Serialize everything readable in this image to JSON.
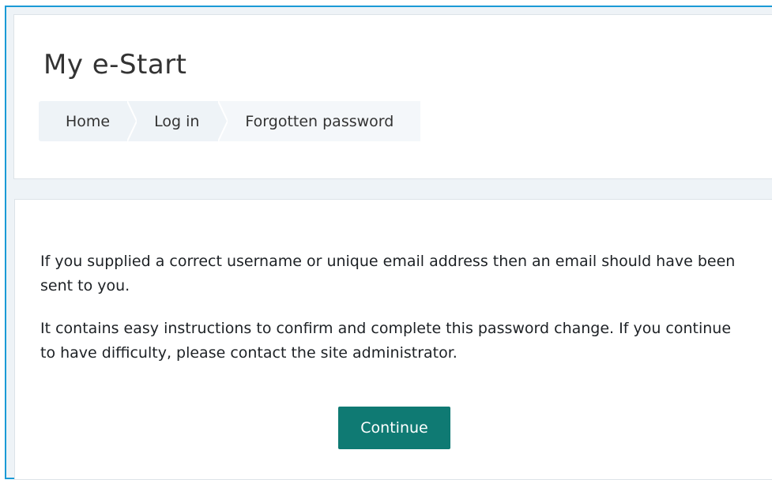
{
  "site": {
    "title": "My e-Start"
  },
  "breadcrumb": {
    "items": [
      {
        "label": "Home"
      },
      {
        "label": "Log in"
      },
      {
        "label": "Forgotten password"
      }
    ]
  },
  "message": {
    "paragraph1": "If you supplied a correct username or unique email address then an email should have been sent to you.",
    "paragraph2": "It contains easy instructions to confirm and complete this password change. If you continue to have difficulty, please contact the site administrator."
  },
  "actions": {
    "continue_label": "Continue"
  },
  "colors": {
    "accent": "#0f7a73",
    "frame_border": "#1a9ad6",
    "page_background": "#eef3f7"
  }
}
